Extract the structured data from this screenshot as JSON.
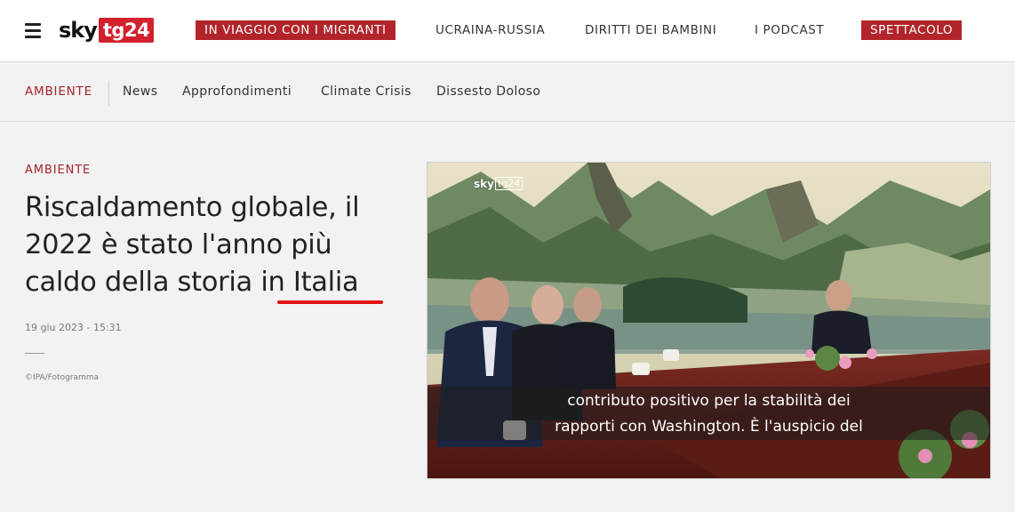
{
  "header": {
    "logo_sky": "sky",
    "logo_tg": "tg24",
    "nav": [
      {
        "label": "IN VIAGGIO CON I MIGRANTI",
        "highlight": true
      },
      {
        "label": "UCRAINA-RUSSIA",
        "highlight": false
      },
      {
        "label": "DIRITTI DEI BAMBINI",
        "highlight": false
      },
      {
        "label": "I PODCAST",
        "highlight": false
      },
      {
        "label": "SPETTACOLO",
        "highlight": true
      }
    ],
    "highlight_color": "#b1252a"
  },
  "subnav": {
    "section": "AMBIENTE",
    "items": [
      "News",
      "Approfondimenti",
      "Climate Crisis",
      "Dissesto Doloso"
    ]
  },
  "article": {
    "kicker": "AMBIENTE",
    "headline_line1": "Riscaldamento globale, il",
    "headline_line2": "2022 è stato l'anno più",
    "headline_line3_a": "caldo della storia ",
    "headline_line3_b": "in Italia",
    "date": "19 giu 2023 - 15:31",
    "credit": "©IPA/Fotogramma"
  },
  "video": {
    "watermark_sky": "sky",
    "watermark_tg": "tg24",
    "subtitle_line1": "contributo positivo per la stabilità dei",
    "subtitle_line2": "rapporti con Washington. È l'auspicio del"
  },
  "colors": {
    "accent": "#a3262b",
    "underline": "#e01010",
    "logo_red": "#d3202d"
  }
}
